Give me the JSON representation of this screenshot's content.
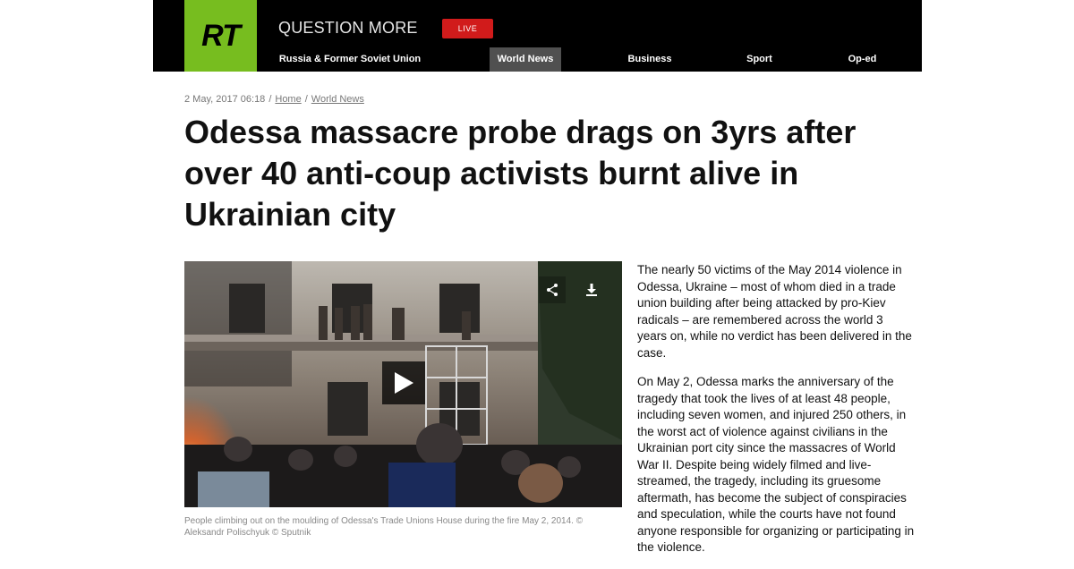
{
  "header": {
    "logo_text": "RT",
    "tagline": "QUESTION MORE",
    "live_label": "LIVE",
    "nav": [
      {
        "label": "Russia & Former Soviet Union",
        "active": false
      },
      {
        "label": "World News",
        "active": true
      },
      {
        "label": "Business",
        "active": false
      },
      {
        "label": "Sport",
        "active": false
      },
      {
        "label": "Op-ed",
        "active": false
      }
    ]
  },
  "article": {
    "date": "2 May, 2017 06:18",
    "breadcrumb": [
      "Home",
      "World News"
    ],
    "title": "Odessa massacre probe drags on 3yrs after over 40 anti-coup activists burnt alive in Ukrainian city",
    "caption": "People climbing out on the moulding of Odessa's Trade Unions House during the fire May 2, 2014. © Aleksandr Polischyuk © Sputnik",
    "paragraphs": [
      "The nearly 50 victims of the May 2014 violence in Odessa, Ukraine – most of whom died in a trade union building after being attacked by pro-Kiev radicals – are remembered across the world 3 years on, while no verdict has been delivered in the case.",
      "On May 2, Odessa marks the anniversary of the tragedy that took the lives of at least 48 people, including seven women, and injured 250 others, in the worst act of violence against civilians in the Ukrainian port city since the massacres of World War II. Despite being widely filmed and live-streamed, the tragedy, including its gruesome aftermath, has become the subject of conspiracies and speculation, while the courts have not found anyone responsible for organizing or participating in the violence."
    ]
  },
  "media": {
    "play_icon": "play-icon",
    "share_icon": "share-icon",
    "download_icon": "download-icon"
  },
  "colors": {
    "header_bg": "#000000",
    "logo_bg": "#77bd1f",
    "live_bg": "#d11b1b",
    "active_nav_bg": "#505050"
  }
}
